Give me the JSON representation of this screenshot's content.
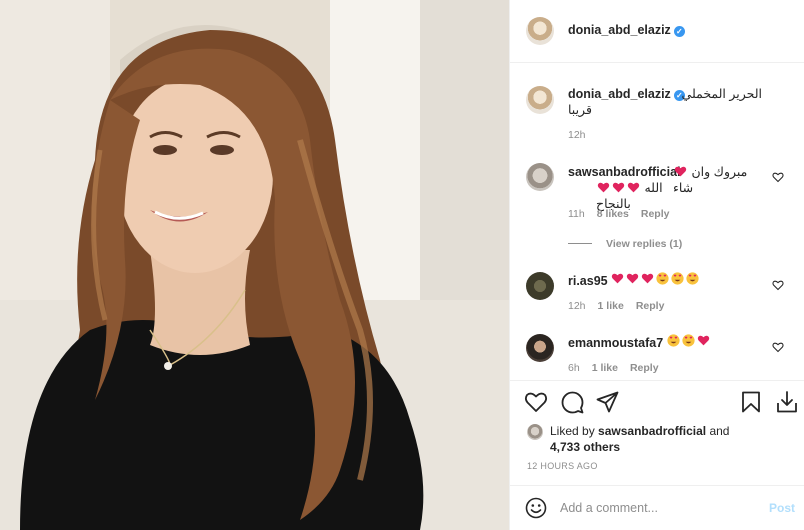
{
  "post": {
    "author": "donia_abd_elaziz",
    "caption_line1": "الحرير المخملي",
    "caption_line2": "قريبا",
    "caption_time": "12h"
  },
  "comments": [
    {
      "user": "sawsanbadrofficial",
      "text_line1": "مبروك وان شاء",
      "text_line2": "الله بالنجاح",
      "emojis_line1": [
        "red-heart"
      ],
      "emojis_line2": [
        "red-heart",
        "red-heart",
        "red-heart"
      ],
      "time": "11h",
      "likes": "8 likes",
      "reply": "Reply",
      "view_replies": "View replies (1)"
    },
    {
      "user": "ri.as95",
      "emojis": [
        "red-heart",
        "red-heart",
        "red-heart",
        "heart-eyes",
        "heart-eyes",
        "heart-eyes"
      ],
      "time": "12h",
      "likes": "1 like",
      "reply": "Reply"
    },
    {
      "user": "emanmoustafa7",
      "emojis": [
        "heart-eyes",
        "heart-eyes",
        "red-heart"
      ],
      "time": "6h",
      "likes": "1 like",
      "reply": "Reply"
    }
  ],
  "liked_by": {
    "prefix": "Liked by",
    "user": "sawsanbadrofficial",
    "and": "and",
    "others": "4,733 others"
  },
  "time_ago": "12 HOURS AGO",
  "add_comment": {
    "placeholder": "Add a comment...",
    "post_label": "Post"
  },
  "icons": {
    "like": "heart-outline-icon",
    "comment": "comment-icon",
    "share": "paper-plane-icon",
    "save": "bookmark-icon",
    "download": "download-icon",
    "emoji": "smiley-icon"
  },
  "colors": {
    "verified": "#3897f0",
    "heart": "#e0245e",
    "post_button": "#b2dffc",
    "muted": "#8e8e8e"
  }
}
